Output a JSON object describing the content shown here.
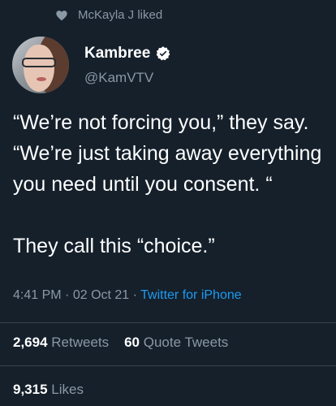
{
  "social_context": {
    "text": "McKayla J liked",
    "icon": "heart-icon"
  },
  "author": {
    "display_name": "Kambree",
    "handle": "@KamVTV",
    "verified": true,
    "verified_icon": "verified-badge-icon"
  },
  "tweet": {
    "lines": [
      "“We’re not forcing you,” they say. “We’re just taking away everything you need until you consent. “",
      "They call this “choice.”"
    ]
  },
  "meta": {
    "time": "4:41 PM",
    "separator": "·",
    "date": "02 Oct 21",
    "source": "Twitter for iPhone"
  },
  "stats": {
    "retweets_count": "2,694",
    "retweets_label": "Retweets",
    "quotes_count": "60",
    "quotes_label": "Quote Tweets",
    "likes_count": "9,315",
    "likes_label": "Likes"
  },
  "colors": {
    "background": "#15202b",
    "secondary_text": "#8b98a5",
    "link": "#1d9bf0",
    "divider": "#38444d"
  }
}
